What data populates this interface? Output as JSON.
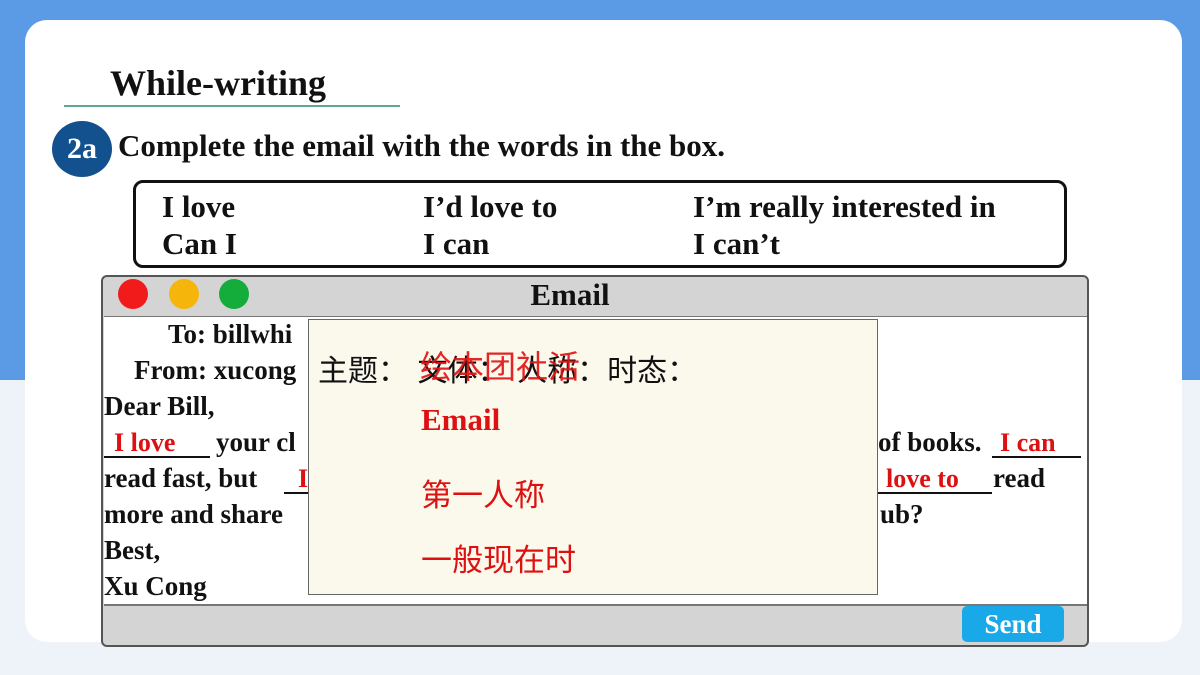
{
  "section": {
    "title": "While-writing"
  },
  "task": {
    "badge": "2a",
    "instruction": "Complete the email with the words in the box."
  },
  "word_box": [
    "I love",
    "I’d love to",
    "I’m really interested in",
    "Can I",
    "I can",
    "I can’t"
  ],
  "email": {
    "title": "Email",
    "to_line": "To: billwhi",
    "from_line": "From: xucong",
    "greeting": "Dear Bill,",
    "line1_mid": "your cl",
    "line1_tail": "of books.",
    "line2_start": "read fast, but",
    "line2_tail": "read",
    "line3_start": "more and share",
    "line3_tail": "ub?",
    "closing": "Best,",
    "signature": "Xu Cong",
    "blanks": {
      "b1": "I love",
      "b2": "I can",
      "b3": "I",
      "b4": "love to"
    },
    "send_label": "Send"
  },
  "overlay": {
    "labels": "主题：  文体：  人称：时态：",
    "theme_answer": "绘本团社活",
    "genre_answer": "Email",
    "person_answer": "第一人称",
    "tense_answer": "一般现在时"
  },
  "colors": {
    "accent_blue": "#5b9be6",
    "badge_blue": "#13508e",
    "answer_red": "#dd1111",
    "send_blue": "#1aa9e8"
  }
}
